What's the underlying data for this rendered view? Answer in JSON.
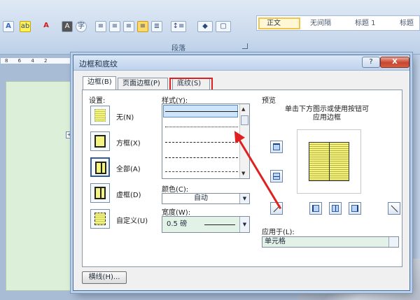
{
  "ribbon": {
    "paragraph_group_label": "段落",
    "styles": [
      "正文",
      "无间隔",
      "标题 1",
      "标题"
    ],
    "ruler_ticks": "8 6 4 2"
  },
  "dialog": {
    "title": "边框和底纹",
    "help_button": "?",
    "close_button": "X",
    "tabs": [
      {
        "label": "边框(B)",
        "active": true
      },
      {
        "label": "页面边框(P)",
        "active": false
      },
      {
        "label": "底纹(S)",
        "active": false
      }
    ],
    "settings": {
      "title": "设置:",
      "items": [
        {
          "label": "无(N)",
          "icon": "table-none-icon"
        },
        {
          "label": "方框(X)",
          "icon": "table-box-icon"
        },
        {
          "label": "全部(A)",
          "icon": "table-all-icon"
        },
        {
          "label": "虚框(D)",
          "icon": "table-grid-icon"
        },
        {
          "label": "自定义(U)",
          "icon": "table-custom-icon"
        }
      ],
      "selected": "全部(A)"
    },
    "style": {
      "title": "样式(Y):"
    },
    "color": {
      "title": "颜色(C):",
      "value": "自动"
    },
    "width": {
      "title": "宽度(W):",
      "value": "0.5 磅"
    },
    "preview": {
      "title": "预览",
      "hint_line1": "单击下方图示或使用按钮可",
      "hint_line2": "应用边框"
    },
    "apply_to": {
      "title": "应用于(L):",
      "value": "单元格"
    },
    "horizontal_line_button": "横线(H)..."
  },
  "colors": {
    "highlight_red": "#e02020",
    "selection_blue": "#2f5aa0"
  }
}
